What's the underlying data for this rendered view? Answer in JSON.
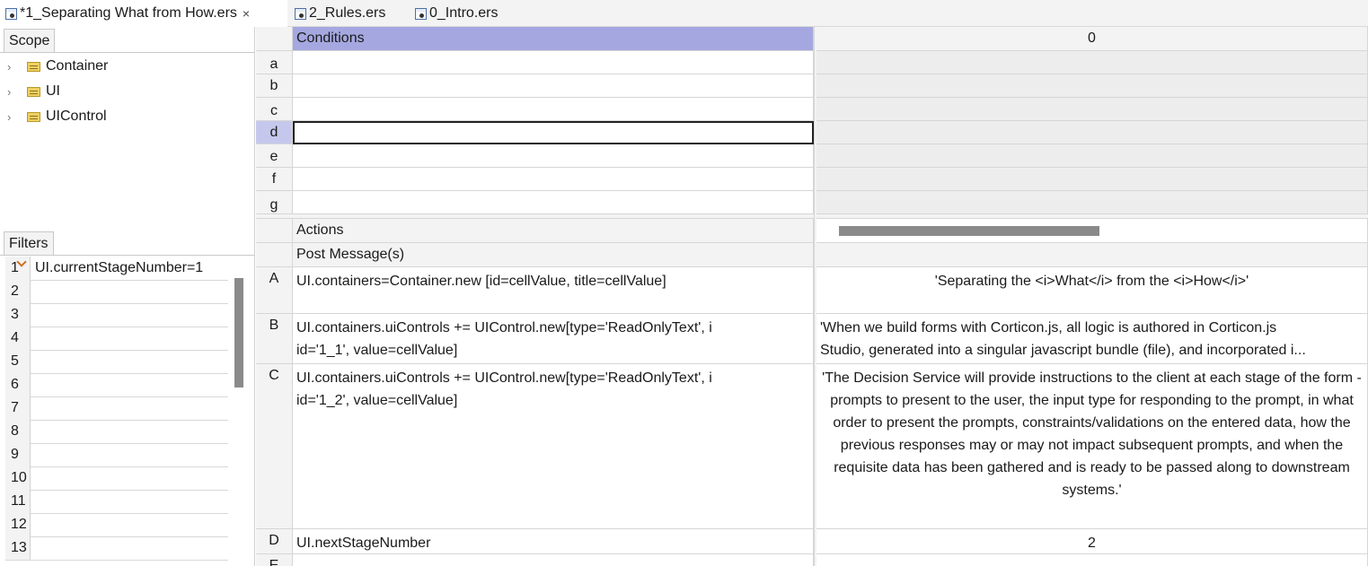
{
  "tabs": [
    {
      "label": "*1_Separating What from How.ers",
      "close": "×"
    },
    {
      "label": "2_Rules.ers"
    },
    {
      "label": "0_Intro.ers"
    }
  ],
  "scope": {
    "title": "Scope",
    "items": [
      "Container",
      "UI",
      "UIControl"
    ]
  },
  "filters": {
    "title": "Filters",
    "rows": [
      {
        "num": "1",
        "value": "UI.currentStageNumber=1"
      },
      {
        "num": "2",
        "value": ""
      },
      {
        "num": "3",
        "value": ""
      },
      {
        "num": "4",
        "value": ""
      },
      {
        "num": "5",
        "value": ""
      },
      {
        "num": "6",
        "value": ""
      },
      {
        "num": "7",
        "value": ""
      },
      {
        "num": "8",
        "value": ""
      },
      {
        "num": "9",
        "value": ""
      },
      {
        "num": "10",
        "value": ""
      },
      {
        "num": "11",
        "value": ""
      },
      {
        "num": "12",
        "value": ""
      },
      {
        "num": "13",
        "value": ""
      }
    ]
  },
  "conditions": {
    "title": "Conditions",
    "column": "0",
    "rows": [
      "a",
      "b",
      "c",
      "d",
      "e",
      "f",
      "g"
    ],
    "selected": "d"
  },
  "actions": {
    "title": "Actions",
    "post_message": "Post Message(s)",
    "rows": [
      {
        "label": "A",
        "expr": "UI.containers=Container.new [id=cellValue, title=cellValue]",
        "value": "'Separating the <i>What</i> from the <i>How</i>'"
      },
      {
        "label": "B",
        "expr": "UI.containers.uiControls += UIControl.new[type='ReadOnlyText', i\nid='1_1', value=cellValue]",
        "value": "'When we build forms with Corticon.js, all logic is authored in Corticon.js\nStudio, generated into a singular javascript bundle (file), and incorporated i..."
      },
      {
        "label": "C",
        "expr": "UI.containers.uiControls += UIControl.new[type='ReadOnlyText', i\nid='1_2', value=cellValue]",
        "value": "'The Decision Service will provide instructions to the client at each stage of the form - prompts to present to the user, the input type for responding to the prompt, in what order to present the prompts, constraints/validations on the entered data, how the previous responses may or may not impact subsequent prompts, and when the requisite data has been gathered and is ready to be passed along to downstream systems.'"
      },
      {
        "label": "D",
        "expr": "UI.nextStageNumber",
        "value": "2"
      },
      {
        "label": "E",
        "expr": "",
        "value": ""
      }
    ]
  },
  "colors": {
    "conditions_header": "#a5a8e0",
    "selected_row_label": "#c5c8ec",
    "filter_icon": "#d07020"
  }
}
